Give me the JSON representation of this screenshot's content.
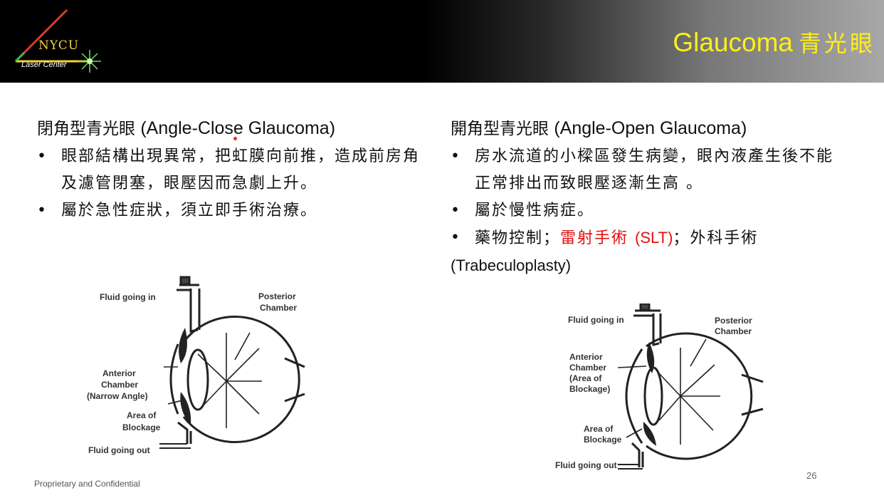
{
  "header": {
    "logo_text": "NYCU",
    "logo_sub": "Laser Center",
    "title_en": "Glaucoma",
    "title_zh": "青光眼"
  },
  "left": {
    "heading_zh": "閉角型青光眼 ",
    "heading_en": "(Angle-Close Glaucoma)",
    "bullets": [
      "眼部結構出現異常，把虹膜向前推，造成前房角及濾管閉塞，眼壓因而急劇上升。",
      "屬於急性症狀，須立即手術治療。"
    ],
    "diagram": {
      "fluid_in": "Fluid going in",
      "posterior_1": "Posterior",
      "posterior_2": "Chamber",
      "anterior_1": "Anterior",
      "anterior_2": "Chamber",
      "anterior_3": "(Narrow Angle)",
      "blockage_1": "Area of",
      "blockage_2": "Blockage",
      "fluid_out": "Fluid going out"
    }
  },
  "right": {
    "heading_zh": "開角型青光眼 ",
    "heading_en": "(Angle-Open Glaucoma)",
    "bullet1": "房水流道的小樑區發生病變，眼內液產生後不能正常排出而致眼壓逐漸生高 。",
    "bullet2": "屬於慢性病症。",
    "bullet3_a": "藥物控制；",
    "bullet3_b": "雷射手術",
    "bullet3_c": "(SLT)",
    "bullet3_d": "；外科手術",
    "bullet3_e": "(Trabeculoplasty)",
    "diagram": {
      "fluid_in": "Fluid going in",
      "posterior_1": "Posterior",
      "posterior_2": "Chamber",
      "anterior_1": "Anterior",
      "anterior_2": "Chamber",
      "anterior_3": "(Area of",
      "anterior_4": "Blockage)",
      "blockage_1": "Area of",
      "blockage_2": "Blockage",
      "fluid_out": "Fluid going out"
    }
  },
  "footer": {
    "confidential": "Proprietary and Confidential",
    "page": "26"
  },
  "colors": {
    "title": "#ffef1a",
    "logo": "#f2d23a",
    "highlight": "#e01010"
  }
}
